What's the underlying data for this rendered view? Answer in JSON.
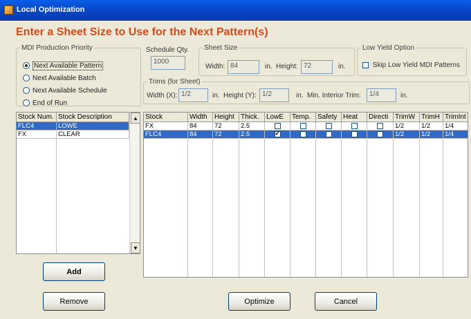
{
  "window": {
    "title": "Local Optimization"
  },
  "heading": "Enter a Sheet Size to Use for the Next Pattern(s)",
  "priority": {
    "legend": "MDI Production Priority",
    "options": [
      {
        "label": "Next Available Pattern",
        "selected": true
      },
      {
        "label": "Next Available Batch",
        "selected": false
      },
      {
        "label": "Next Available Schedule",
        "selected": false
      },
      {
        "label": "End of Run",
        "selected": false
      }
    ]
  },
  "schedule": {
    "legend": "Schedule Qty.",
    "value": "1000"
  },
  "sheet": {
    "legend": "Sheet Size",
    "width_label": "Width:",
    "width_value": "84",
    "unit": "in.",
    "height_label": "Height:",
    "height_value": "72"
  },
  "low_yield": {
    "legend": "Low Yield Option",
    "label": "Skip Low Yield MDI Patterns",
    "checked": false
  },
  "trims": {
    "legend": "Trims (for Sheet)",
    "width_label": "Width (X):",
    "width_value": "1/2",
    "unit": "in.",
    "height_label": "Height (Y):",
    "height_value": "1/2",
    "min_label": "Min. Interior Trim:",
    "min_value": "1/4"
  },
  "stock_list": {
    "headers": [
      "Stock Num.",
      "Stock Description"
    ],
    "rows": [
      {
        "num": "FLC4",
        "desc": "LOWE",
        "selected": true
      },
      {
        "num": "FX",
        "desc": "CLEAR",
        "selected": false
      }
    ]
  },
  "stock_grid": {
    "headers": [
      "Stock",
      "Width",
      "Height",
      "Thick.",
      "LowE",
      "Temp.",
      "Safety",
      "Heat",
      "Directi",
      "TrimW",
      "TrimH",
      "TrimInt"
    ],
    "rows": [
      {
        "stock": "FX",
        "width": "84",
        "height": "72",
        "thick": "2.5",
        "lowe": false,
        "temp": false,
        "safety": false,
        "heat": false,
        "direct": false,
        "trimw": "1/2",
        "trimh": "1/2",
        "trimint": "1/4",
        "selected": false
      },
      {
        "stock": "FLC4",
        "width": "84",
        "height": "72",
        "thick": "2.5",
        "lowe": true,
        "temp": false,
        "safety": false,
        "heat": false,
        "direct": false,
        "trimw": "1/2",
        "trimh": "1/2",
        "trimint": "1/4",
        "selected": true
      }
    ]
  },
  "buttons": {
    "add": "Add",
    "remove": "Remove",
    "optimize": "Optimize",
    "cancel": "Cancel"
  },
  "icons": {
    "title": "app-window-icon",
    "scroll_up": "arrow-up-icon",
    "scroll_down": "arrow-down-icon"
  }
}
